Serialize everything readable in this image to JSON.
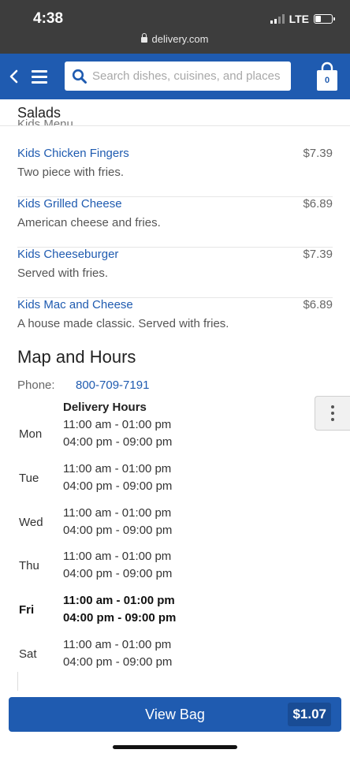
{
  "status_bar": {
    "time": "4:38",
    "network": "LTE",
    "battery_level": 0.3,
    "url": "delivery.com"
  },
  "header": {
    "search_placeholder": "Search dishes, cuisines, and places",
    "bag_count": "0",
    "accent_color": "#1f5bb0"
  },
  "menu": {
    "current_category": "Salads",
    "previous_category_partial": "Kids Menu",
    "items": [
      {
        "name": "Kids Chicken Fingers",
        "price": "$7.39",
        "description": "Two piece with fries."
      },
      {
        "name": "Kids Grilled Cheese",
        "price": "$6.89",
        "description": "American cheese and fries."
      },
      {
        "name": "Kids Cheeseburger",
        "price": "$7.39",
        "description": "Served with fries."
      },
      {
        "name": "Kids Mac and Cheese",
        "price": "$6.89",
        "description": "A house made classic. Served with fries."
      }
    ]
  },
  "map_hours": {
    "title": "Map and Hours",
    "phone_label": "Phone:",
    "phone": "800-709-7191",
    "hours_title": "Delivery Hours",
    "days": [
      {
        "day": "Mon",
        "range1": "11:00 am - 01:00 pm",
        "range2": "04:00 pm - 09:00 pm",
        "today": false
      },
      {
        "day": "Tue",
        "range1": "11:00 am - 01:00 pm",
        "range2": "04:00 pm - 09:00 pm",
        "today": false
      },
      {
        "day": "Wed",
        "range1": "11:00 am - 01:00 pm",
        "range2": "04:00 pm - 09:00 pm",
        "today": false
      },
      {
        "day": "Thu",
        "range1": "11:00 am - 01:00 pm",
        "range2": "04:00 pm - 09:00 pm",
        "today": false
      },
      {
        "day": "Fri",
        "range1": "11:00 am - 01:00 pm",
        "range2": "04:00 pm - 09:00 pm",
        "today": true
      },
      {
        "day": "Sat",
        "range1": "11:00 am - 01:00 pm",
        "range2": "04:00 pm - 09:00 pm",
        "today": false
      }
    ]
  },
  "bottom_bar": {
    "view_bag_label": "View Bag",
    "total": "$1.07"
  },
  "icons": {
    "back": "chevron-left-icon",
    "menu": "hamburger-menu-icon",
    "search": "search-icon",
    "bag": "shopping-bag-icon",
    "more": "more-vertical-icon",
    "lock": "lock-icon",
    "signal": "signal-icon",
    "battery": "battery-icon"
  }
}
